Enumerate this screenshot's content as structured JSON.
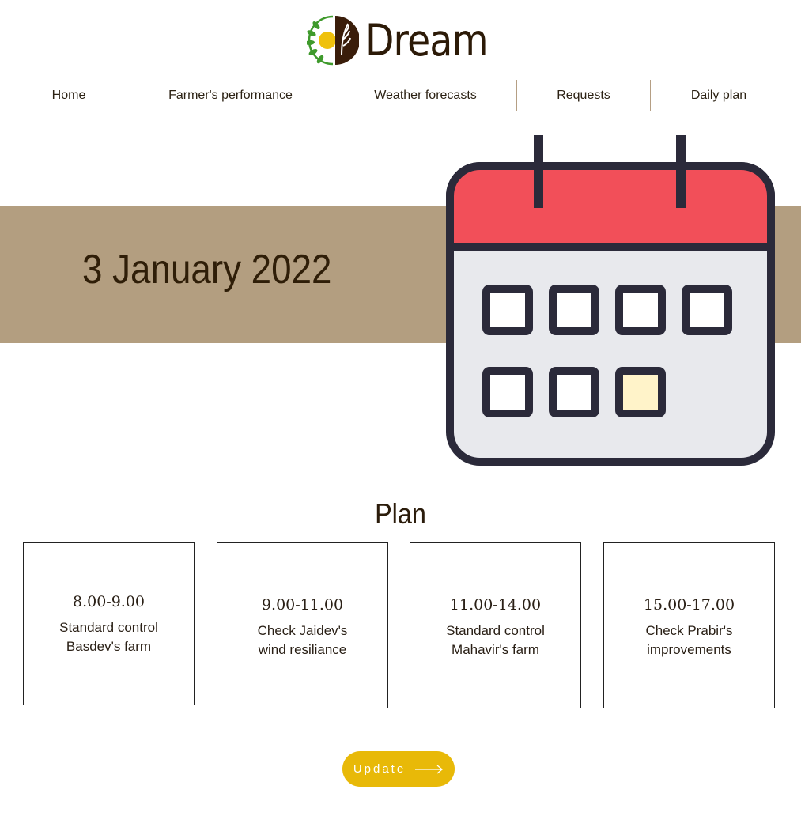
{
  "brand": {
    "name": "Dream"
  },
  "nav": {
    "items": [
      {
        "label": "Home"
      },
      {
        "label": "Farmer's performance"
      },
      {
        "label": "Weather forecasts"
      },
      {
        "label": "Requests"
      },
      {
        "label": "Daily plan"
      }
    ]
  },
  "hero": {
    "date": "3 January 2022",
    "band_color": "#b39e80",
    "icon": "calendar-icon"
  },
  "plan": {
    "title": "Plan",
    "items": [
      {
        "time": "8.00-9.00",
        "description": "Standard control\nBasdev's farm"
      },
      {
        "time": "9.00-11.00",
        "description": "Check Jaidev's\nwind resiliance"
      },
      {
        "time": "11.00-14.00",
        "description": "Standard control\nMahavir's farm"
      },
      {
        "time": "15.00-17.00",
        "description": "Check Prabir's\nimprovements"
      }
    ]
  },
  "update_button": {
    "label": "Update",
    "color": "#e8b908",
    "icon": "arrow-right-icon"
  }
}
